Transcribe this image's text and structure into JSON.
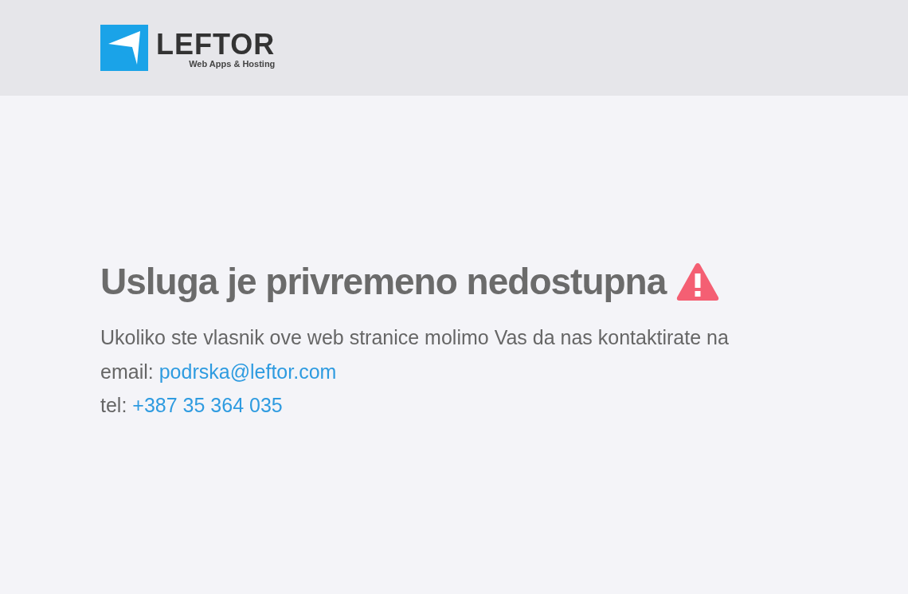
{
  "header": {
    "logo": {
      "name": "LEFTOR",
      "tagline": "Web Apps & Hosting"
    }
  },
  "notice": {
    "title": "Usluga je privremeno nedostupna",
    "message": "Ukoliko ste vlasnik ove web stranice molimo Vas da nas kontaktirate na",
    "contacts": [
      {
        "label": "email:",
        "value": "podrska@leftor.com"
      },
      {
        "label": "tel:",
        "value": "+387 35 364 035"
      }
    ]
  }
}
